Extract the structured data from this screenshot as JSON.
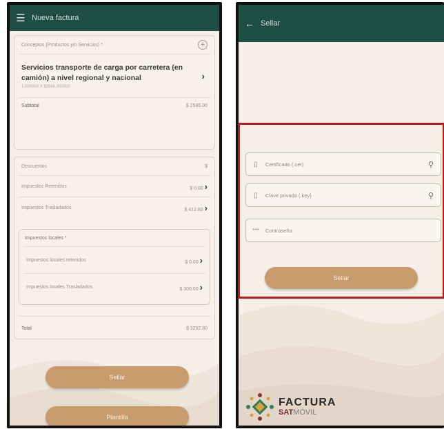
{
  "left": {
    "title": "Nueva factura",
    "conceptos_label": "Conceptos (Productos y/o Servicios) *",
    "concept_text": "Servicios transporte de carga por carretera (en camión) a nivel regional y nacional",
    "concept_detail": "1.000000 X $2580.000000",
    "subtotal_label": "Subtotal",
    "subtotal_value": "$ 2580.00",
    "descuentos_label": "Descuentos",
    "descuentos_value": "$",
    "ret_label": "Impuestos Retenidos",
    "ret_value": "$ 0.00",
    "tras_label": "Impuestos Trasladados",
    "tras_value": "$ 412.80",
    "locales_label": "Impuestos locales *",
    "loc_ret_label": "Impuestos locales retenidos",
    "loc_ret_value": "$ 0.00",
    "loc_tras_label": "Impuestos locales Trasladados",
    "loc_tras_value": "$ 300.00",
    "total_label": "Total",
    "total_value": "$ 3292.80",
    "sellar_button": "Sellar",
    "plantilla_button": "Plantilla"
  },
  "right": {
    "title": "Sellar",
    "cert_placeholder": "Certificado (.cer)",
    "key_placeholder": "Clave privada (.key)",
    "pass_placeholder": "Contraseña",
    "sellar_button": "Sellar",
    "brand_line1": "FACTURA",
    "brand_sat": "SAT",
    "brand_movil": "MÓVIL"
  },
  "colors": {
    "appbar": "#1f4e43",
    "button": "#c79b6c",
    "highlight": "#c01818"
  },
  "icons": [
    "menu-icon",
    "add-circle-icon",
    "chevron-right-icon",
    "back-arrow-icon",
    "file-icon",
    "search-icon",
    "password-icon"
  ]
}
